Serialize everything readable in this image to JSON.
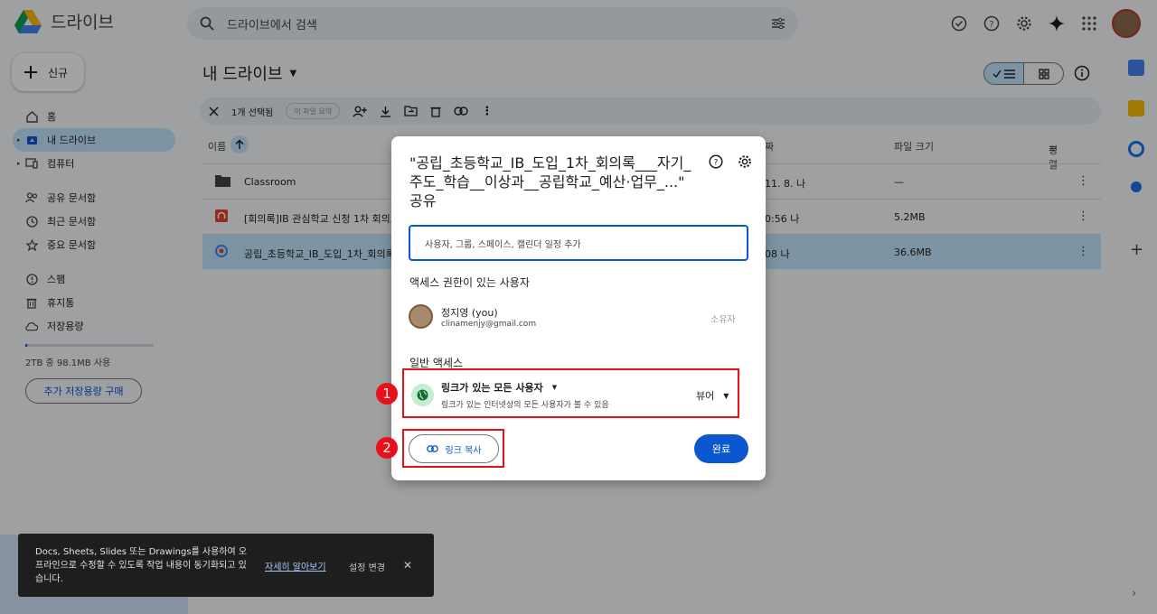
{
  "app": {
    "name": "드라이브"
  },
  "search": {
    "placeholder": "드라이브에서 검색"
  },
  "header_icons": [
    "check-circle-icon",
    "help-icon",
    "settings-icon",
    "gemini-icon",
    "apps-grid-icon"
  ],
  "sidebar": {
    "new_label": "신규",
    "items": [
      {
        "label": "홈",
        "icon": "home-icon"
      },
      {
        "label": "내 드라이브",
        "icon": "my-drive-icon",
        "active": true
      },
      {
        "label": "컴퓨터",
        "icon": "computer-icon"
      },
      {
        "label": "공유 문서함",
        "icon": "shared-icon"
      },
      {
        "label": "최근 문서함",
        "icon": "clock-icon"
      },
      {
        "label": "중요 문서함",
        "icon": "star-icon"
      },
      {
        "label": "스팸",
        "icon": "spam-icon"
      },
      {
        "label": "휴지통",
        "icon": "trash-icon"
      },
      {
        "label": "저장용량",
        "icon": "cloud-icon"
      }
    ],
    "storage_text": "2TB 중 98.1MB 사용",
    "buy_label": "추가 저장용량 구매"
  },
  "main": {
    "title": "내 드라이브",
    "selection": {
      "count_text": "1개 선택됨",
      "summary_chip": "이 파일 요약"
    },
    "columns": {
      "name": "이름",
      "modified": "짜",
      "size": "파일 크기",
      "sort": "정렬"
    },
    "rows": [
      {
        "name": "Classroom",
        "date": "11. 8. 나",
        "size": "—"
      },
      {
        "name": "[회의록]IB 관심학교 신청 1차 회의로",
        "date": "0:56 나",
        "size": "5.2MB"
      },
      {
        "name": "공립_초등학교_IB_도입_1차_회의록",
        "date": "08 나",
        "size": "36.6MB"
      }
    ]
  },
  "dialog": {
    "title": "\"공립_초등학교_IB_도입_1차_회의록___자기_주도_학습__이상과__공립학교_예산·업무_...\" 공유",
    "input_placeholder": "사용자, 그룹, 스페이스, 캘린더 일정 추가",
    "access_label": "액세스 권한이 있는 사용자",
    "person": {
      "name": "정지영 (you)",
      "email": "clinamenjy@gmail.com",
      "role": "소유자"
    },
    "general_label": "일반 액세스",
    "general_access": {
      "title": "링크가 있는 모든 사용자",
      "sub": "링크가 있는 인터넷상의 모든 사용자가 볼 수 있음",
      "role": "뷰어"
    },
    "copy_label": "링크 복사",
    "done_label": "완료"
  },
  "annotations": {
    "one": "1",
    "two": "2"
  },
  "snackbar": {
    "message": "Docs, Sheets, Slides 또는 Drawings를 사용하여 오프라인으로 수정할 수 있도록 작업 내용이 동기화되고 있습니다.",
    "learn_more": "자세히 알아보기",
    "settings": "설정 변경"
  },
  "colors": {
    "accent": "#0b57d0",
    "selected": "#c2e7ff",
    "annotation": "#e8111a"
  }
}
